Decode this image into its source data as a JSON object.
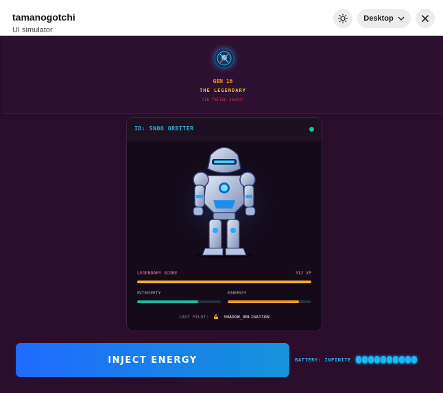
{
  "titlebar": {
    "app_title": "tamanogotchi",
    "subtitle": "UI simulator",
    "view_mode": "Desktop",
    "theme_icon": "sun-icon",
    "close_icon": "close-icon"
  },
  "header": {
    "gen": "GEN 16",
    "title": "THE LEGENDARY",
    "fallen": "(16 fallen souls)"
  },
  "card": {
    "id_label": "ID: SNOO ORBITER",
    "status_color": "#16c784",
    "legendary_score_label": "LEGENDARY SCORE",
    "legendary_score_value": "312 XP",
    "score_fill": 1.0,
    "stats": [
      {
        "label": "INTEGRITY",
        "fill": 0.73,
        "color": "#1abc9c"
      },
      {
        "label": "ENERGY",
        "fill": 0.85,
        "color": "#f39c1e"
      }
    ],
    "pilot_label": "LAST PILOT:",
    "pilot_icon": "💪",
    "pilot_name": "SHADOW_OBLIGATION"
  },
  "actions": {
    "inject_label": "INJECT ENERGY"
  },
  "battery": {
    "label": "BATTERY: INFINITE",
    "cells": 10
  },
  "colors": {
    "accent_blue": "#2fb7f5",
    "score_bar": "#f3b12b",
    "background": "#2a0e2c"
  }
}
